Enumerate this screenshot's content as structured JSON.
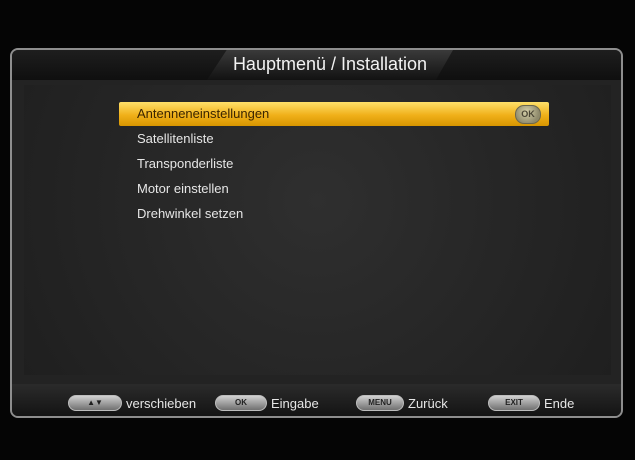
{
  "title": "Hauptmenü / Installation",
  "menu": {
    "items": [
      {
        "label": "Antenneneinstellungen",
        "selected": true,
        "badge": "OK"
      },
      {
        "label": "Satellitenliste"
      },
      {
        "label": "Transponderliste"
      },
      {
        "label": "Motor einstellen"
      },
      {
        "label": "Drehwinkel setzen"
      }
    ]
  },
  "footer": {
    "move": {
      "key": "▲▼",
      "label": "verschieben",
      "icon": "updown-key-icon"
    },
    "enter": {
      "key": "OK",
      "label": "Eingabe",
      "icon": "ok-key-icon"
    },
    "back": {
      "key": "MENU",
      "label": "Zurück",
      "icon": "menu-key-icon"
    },
    "exit": {
      "key": "EXIT",
      "label": "Ende",
      "icon": "exit-key-icon"
    }
  },
  "colors": {
    "selection": "#f0b019",
    "background": "#232323",
    "frame": "#8e8e8e"
  }
}
